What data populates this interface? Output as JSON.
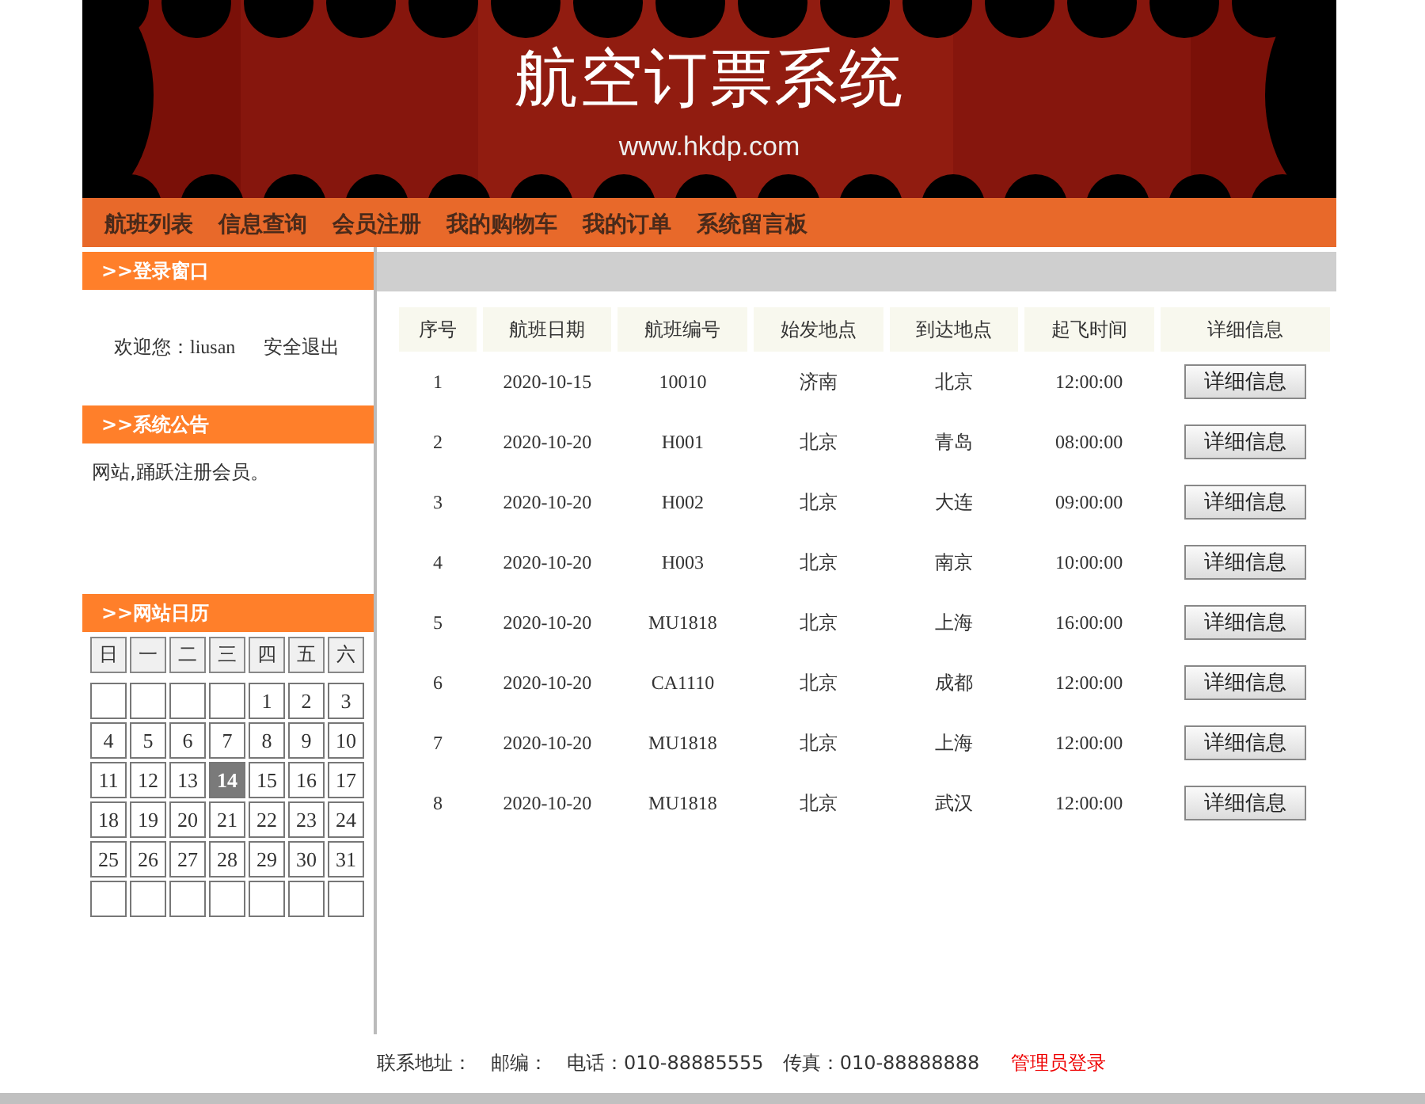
{
  "banner": {
    "title": "航空订票系统",
    "url": "www.hkdp.com"
  },
  "nav": [
    {
      "label": "航班列表"
    },
    {
      "label": "信息查询"
    },
    {
      "label": "会员注册"
    },
    {
      "label": "我的购物车"
    },
    {
      "label": "我的订单"
    },
    {
      "label": "系统留言板"
    }
  ],
  "login_panel": {
    "title": ">>登录窗口",
    "welcome": "欢迎您：",
    "username": "liusan",
    "logout": "安全退出"
  },
  "notice_panel": {
    "title": ">>系统公告",
    "text": "网站,踊跃注册会员。"
  },
  "calendar_panel": {
    "title": ">>网站日历",
    "weekdays": [
      "日",
      "一",
      "二",
      "三",
      "四",
      "五",
      "六"
    ],
    "weeks": [
      [
        {
          "kind": "blank"
        },
        {
          "kind": "blank"
        },
        {
          "kind": "blank"
        },
        {
          "kind": "blank"
        },
        {
          "kind": "day",
          "day": "1",
          "selected": false
        },
        {
          "kind": "day",
          "day": "2",
          "selected": false
        },
        {
          "kind": "day",
          "day": "3",
          "selected": false
        }
      ],
      [
        {
          "kind": "day",
          "day": "4",
          "selected": false
        },
        {
          "kind": "day",
          "day": "5",
          "selected": false
        },
        {
          "kind": "day",
          "day": "6",
          "selected": false
        },
        {
          "kind": "day",
          "day": "7",
          "selected": false
        },
        {
          "kind": "day",
          "day": "8",
          "selected": false
        },
        {
          "kind": "day",
          "day": "9",
          "selected": false
        },
        {
          "kind": "day",
          "day": "10",
          "selected": false
        }
      ],
      [
        {
          "kind": "day",
          "day": "11",
          "selected": false
        },
        {
          "kind": "day",
          "day": "12",
          "selected": false
        },
        {
          "kind": "day",
          "day": "13",
          "selected": false
        },
        {
          "kind": "day",
          "day": "14",
          "selected": true
        },
        {
          "kind": "day",
          "day": "15",
          "selected": false
        },
        {
          "kind": "day",
          "day": "16",
          "selected": false
        },
        {
          "kind": "day",
          "day": "17",
          "selected": false
        }
      ],
      [
        {
          "kind": "day",
          "day": "18",
          "selected": false
        },
        {
          "kind": "day",
          "day": "19",
          "selected": false
        },
        {
          "kind": "day",
          "day": "20",
          "selected": false
        },
        {
          "kind": "day",
          "day": "21",
          "selected": false
        },
        {
          "kind": "day",
          "day": "22",
          "selected": false
        },
        {
          "kind": "day",
          "day": "23",
          "selected": false
        },
        {
          "kind": "day",
          "day": "24",
          "selected": false
        }
      ],
      [
        {
          "kind": "day",
          "day": "25",
          "selected": false
        },
        {
          "kind": "day",
          "day": "26",
          "selected": false
        },
        {
          "kind": "day",
          "day": "27",
          "selected": false
        },
        {
          "kind": "day",
          "day": "28",
          "selected": false
        },
        {
          "kind": "day",
          "day": "29",
          "selected": false
        },
        {
          "kind": "day",
          "day": "30",
          "selected": false
        },
        {
          "kind": "day",
          "day": "31",
          "selected": false
        }
      ],
      [
        {
          "kind": "blank"
        },
        {
          "kind": "blank"
        },
        {
          "kind": "blank"
        },
        {
          "kind": "blank"
        },
        {
          "kind": "blank"
        },
        {
          "kind": "blank"
        },
        {
          "kind": "blank"
        }
      ]
    ]
  },
  "table": {
    "columns": [
      "序号",
      "航班日期",
      "航班编号",
      "始发地点",
      "到达地点",
      "起飞时间",
      "详细信息"
    ],
    "rows": [
      [
        "1",
        "2020-10-15",
        "10010",
        "济南",
        "北京",
        "12:00:00",
        "详细信息"
      ],
      [
        "2",
        "2020-10-20",
        "H001",
        "北京",
        "青岛",
        "08:00:00",
        "详细信息"
      ],
      [
        "3",
        "2020-10-20",
        "H002",
        "北京",
        "大连",
        "09:00:00",
        "详细信息"
      ],
      [
        "4",
        "2020-10-20",
        "H003",
        "北京",
        "南京",
        "10:00:00",
        "详细信息"
      ],
      [
        "5",
        "2020-10-20",
        "MU1818",
        "北京",
        "上海",
        "16:00:00",
        "详细信息"
      ],
      [
        "6",
        "2020-10-20",
        "CA1110",
        "北京",
        "成都",
        "12:00:00",
        "详细信息"
      ],
      [
        "7",
        "2020-10-20",
        "MU1818",
        "北京",
        "上海",
        "12:00:00",
        "详细信息"
      ],
      [
        "8",
        "2020-10-20",
        "MU1818",
        "北京",
        "武汉",
        "12:00:00",
        "详细信息"
      ]
    ]
  },
  "footer": {
    "address": "联系地址：",
    "postcode": "邮编：",
    "phone": "电话：010-88885555",
    "fax": "传真：010-88888888",
    "admin_link": "管理员登录"
  }
}
